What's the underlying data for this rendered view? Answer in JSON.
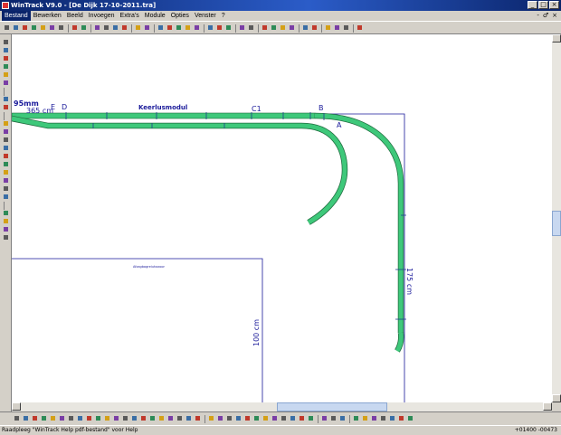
{
  "window": {
    "title": "WinTrack V9.0 - [De Dijk 17-10-2011.tra]",
    "min_label": "_",
    "max_label": "□",
    "close_label": "×"
  },
  "menu": {
    "items": [
      "Bestand",
      "Bewerken",
      "Beeld",
      "Invoegen",
      "Extra's",
      "Module",
      "Opties",
      "Venster",
      "?"
    ],
    "mdi_buttons": [
      "-",
      "♂",
      "×"
    ]
  },
  "icons": {
    "toolbar": [
      "new-icon",
      "open-icon",
      "save-icon",
      "print-icon",
      "print-preview-icon",
      "copy-icon",
      "paste-icon",
      "separator",
      "layer-icon",
      "grid-icon",
      "separator",
      "zoom-in-icon",
      "zoom-out-icon",
      "zoom-fit-icon",
      "zoom-window-icon",
      "separator",
      "undo-icon",
      "redo-icon",
      "separator",
      "track-icon",
      "lock-icon",
      "cut-icon",
      "delete-icon",
      "mirror-icon",
      "separator",
      "measure-icon",
      "line-icon",
      "pen-icon",
      "separator",
      "align-icon",
      "align-icon",
      "separator",
      "module-icon",
      "module-icon",
      "module-icon",
      "module-icon",
      "separator",
      "module-icon",
      "module-icon",
      "separator",
      "module-icon",
      "module-icon",
      "module-icon",
      "separator",
      "help-icon"
    ],
    "left": [
      "curve-icon",
      "curve-icon",
      "switch-icon",
      "switch-icon",
      "switch-icon",
      "warning-icon",
      "separator",
      "line-icon",
      "rect-icon",
      "separator",
      "signal-icon",
      "signal-icon",
      "text-icon",
      "symbol-icon",
      "house-icon",
      "house-icon",
      "tree-icon",
      "tree-icon",
      "color-icon",
      "color-icon",
      "separator",
      "ladder-icon",
      "ladder-icon",
      "flag-icon",
      "flag-icon"
    ],
    "bottom": [
      "layer-icon",
      "arrow-icon",
      "color-icon",
      "color-icon",
      "color-icon",
      "color-icon",
      "color-icon",
      "color-icon",
      "color-icon",
      "color-icon",
      "color-icon",
      "grid-icon",
      "grid-icon",
      "grid-icon",
      "grid-icon",
      "grid-icon",
      "grid-icon",
      "grid-icon",
      "grid-icon",
      "grid-icon",
      "grid-icon",
      "separator",
      "layer-icon",
      "layer-icon",
      "layer-icon",
      "layer-icon",
      "layer-icon",
      "layer-icon",
      "layer-icon",
      "layer-icon",
      "layer-icon",
      "layer-icon",
      "layer-icon",
      "layer-icon",
      "separator",
      "tool-icon",
      "tool-icon",
      "tool-icon",
      "separator",
      "tool-icon",
      "tool-icon",
      "tool-icon",
      "tool-icon",
      "tool-icon",
      "tool-icon",
      "tool-icon"
    ]
  },
  "colors": {
    "track": "#3ec87a",
    "track_edge": "#1f6b3e",
    "label_blue": "#1a1a9a",
    "title_blue": "#0a246a"
  },
  "canvas": {
    "labels": {
      "dim_95mm": "95mm",
      "dim_365cm": "365 cm",
      "mark_E": "E",
      "mark_D": "D",
      "module_name": "Keerlusmodul",
      "mark_C1": "C1",
      "mark_B": "B",
      "mark_A": "A",
      "dim_175cm": "175 cm",
      "dim_100cm": "100 cm",
      "mod_text": "Afzagbagreiuhazoor"
    }
  },
  "status": {
    "message": "Raadpleeg \"WinTrack Help pdf-bestand\" voor Help",
    "coords": "+01400 -00473"
  }
}
